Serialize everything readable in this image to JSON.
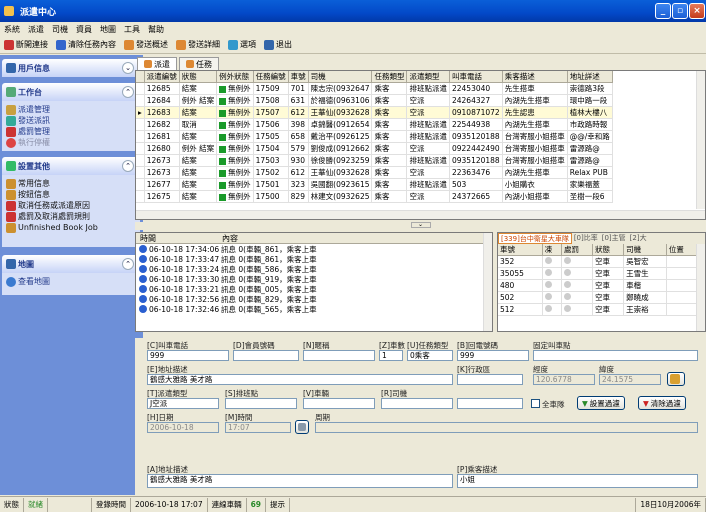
{
  "title": "派遣中心",
  "menu": [
    "系統",
    "派遣",
    "司機",
    "資員",
    "地圖",
    "工具",
    "幫助"
  ],
  "toolbar": {
    "b1": "斷開連接",
    "b2": "清除任務內容",
    "b3": "發送概述",
    "b4": "發送詳細",
    "b5": "選項",
    "b6": "退出"
  },
  "left": {
    "h1": "用戶信息",
    "h2": "工作台",
    "work": [
      "派遣管理",
      "發送派訊",
      "處罰管理",
      "執行停權"
    ],
    "h3": "設置其他",
    "other": [
      "常用信息",
      "按鈕信息",
      "取消任務或派遣原因",
      "處罰及取消處罰規則",
      "Unfinished Book Job"
    ],
    "h4": "地圖",
    "map": [
      "查看地圖"
    ]
  },
  "tabs": [
    "派遣",
    "任務"
  ],
  "grid": {
    "cols": [
      "派遣編號",
      "狀態",
      "例外狀態",
      "任務編號",
      "車號",
      "司機",
      "任務類型",
      "派遣類型",
      "叫車電話",
      "乘客描述",
      "地址詳述"
    ],
    "rows": [
      [
        "12685",
        "結案",
        "無例外",
        "17509",
        "701",
        "陳志宗(0932647",
        "乘客",
        "排班點派遣",
        "22453040",
        "先生搭車",
        "崇德路3段"
      ],
      [
        "12684",
        "例外 結案",
        "無例外",
        "17508",
        "631",
        "於福德(0963106",
        "乘客",
        "空派",
        "24264327",
        "內湖先生搭車",
        "環中路一段"
      ],
      [
        "12683",
        "結案",
        "無例外",
        "17507",
        "612",
        "王華仙(0932628",
        "乘客",
        "空派",
        "0910871072",
        "先生認患",
        "植林大樓八"
      ],
      [
        "12682",
        "取消",
        "無例外",
        "17506",
        "398",
        "卓錦醫(0912654",
        "乘客",
        "排班點派遣",
        "22544938",
        "內湖先生搭車",
        "市政路時報"
      ],
      [
        "12681",
        "結案",
        "無例外",
        "17505",
        "658",
        "戴治平(0926125",
        "乘客",
        "排班點派遣",
        "0935120188",
        "台灣寄服小姐搭車",
        "@@/幸和路"
      ],
      [
        "12680",
        "例外 結案",
        "無例外",
        "17504",
        "579",
        "劉俊成(0912662",
        "乘客",
        "空派",
        "0922442490",
        "台灣寄服小姐搭車",
        "雷源路@"
      ],
      [
        "12673",
        "結案",
        "無例外",
        "17503",
        "930",
        "徐俊勝(0923259",
        "乘客",
        "排班點派遣",
        "0935120188",
        "台灣寄服小姐搭車",
        "雷源路@"
      ],
      [
        "12673",
        "結案",
        "無例外",
        "17502",
        "612",
        "王華仙(0932628",
        "乘客",
        "空派",
        "22363476",
        "內湖先生搭車",
        "Relax PUB"
      ],
      [
        "12677",
        "結案",
        "無例外",
        "17501",
        "323",
        "吳國翻(0923615",
        "乘客",
        "排班點派遣",
        "503",
        "小姐購衣",
        "家樂福蓋"
      ],
      [
        "12675",
        "結案",
        "無例外",
        "17500",
        "829",
        "林建文(0932625",
        "乘客",
        "空派",
        "24372665",
        "內湖小姐搭車",
        "圣樹一段6"
      ]
    ]
  },
  "log": {
    "cols": [
      "時間",
      "內容"
    ],
    "rows": [
      [
        "06-10-18 17:34:06",
        "訊息 0(車輛_861，乘客上車"
      ],
      [
        "06-10-18 17:33:47",
        "訊息 0(車輛_861，乘客上車"
      ],
      [
        "06-10-18 17:33:24",
        "訊息 0(車輛_586，乘客上車"
      ],
      [
        "06-10-18 17:33:30",
        "訊息 0(車輛_919，乘客上車"
      ],
      [
        "06-10-18 17:33:21",
        "訊息 0(車輛_005，乘客上車"
      ],
      [
        "06-10-18 17:32:56",
        "訊息 0(車輛_829，乘客上車"
      ],
      [
        "06-10-18 17:32:46",
        "訊息 0(車輛_565，乘客上車"
      ]
    ]
  },
  "car": {
    "tabs": [
      "[339]台中衛星大車隊",
      "[0]比率",
      "[0]主管",
      "[2]大"
    ],
    "cols": [
      "車號",
      "凍",
      "處罰",
      "狀態",
      "司機",
      "位置"
    ],
    "rows": [
      [
        "352",
        "",
        "",
        "空車",
        "吳智宏",
        ""
      ],
      [
        "35055",
        "",
        "",
        "空車",
        "王雪生",
        ""
      ],
      [
        "480",
        "",
        "",
        "空車",
        "車楷",
        ""
      ],
      [
        "502",
        "",
        "",
        "空車",
        "鄭曉成",
        ""
      ],
      [
        "512",
        "",
        "",
        "空車",
        "王崇裕",
        ""
      ]
    ]
  },
  "form": {
    "phone_l": "[C]叫車電話",
    "phone_v": "999",
    "member_l": "[D]會員號碼",
    "alias_l": "[N]暱稱",
    "cars_l": "[Z]車數",
    "cars_v": "1",
    "tasktype_l": "[U]任務類型",
    "tasktype_v": "0乘客",
    "callback_l": "[B]回電號碼",
    "callback_v": "999",
    "fixed_l": "固定叫車點",
    "addr_l": "[E]地址描述",
    "addr_v": "鶴感大雅路 美才路",
    "district_l": "[K]行政區",
    "lon_l": "經度",
    "lon_v": "120.6778",
    "lat_l": "緯度",
    "lat_v": "24.1575",
    "dispatch_l": "[T]派遣類型",
    "dispatch_v": "J空派",
    "queue_l": "[S]排班點",
    "vehicle_l": "[V]車輛",
    "driver_l": "[R]司機",
    "allcar_l": "全車隊",
    "setfilter": "設置過濾",
    "clearfilter": "清除過濾",
    "date_l": "[H]日期",
    "date_v": "2006-10-18",
    "time_l": "[M]時間",
    "time_v": "17:07",
    "period_l": "周期",
    "addrdesc_l": "[A]地址描述",
    "addrdesc_v": "鶴感大雅路 美才路",
    "passdesc_l": "[P]乘客描述",
    "passdesc_v": "小姐"
  },
  "status": [
    "狀態",
    "就緒",
    "",
    "登錄時間",
    "2006-10-18 17:07",
    "連線車輛",
    "69",
    "提示",
    "18日10月2006年"
  ]
}
